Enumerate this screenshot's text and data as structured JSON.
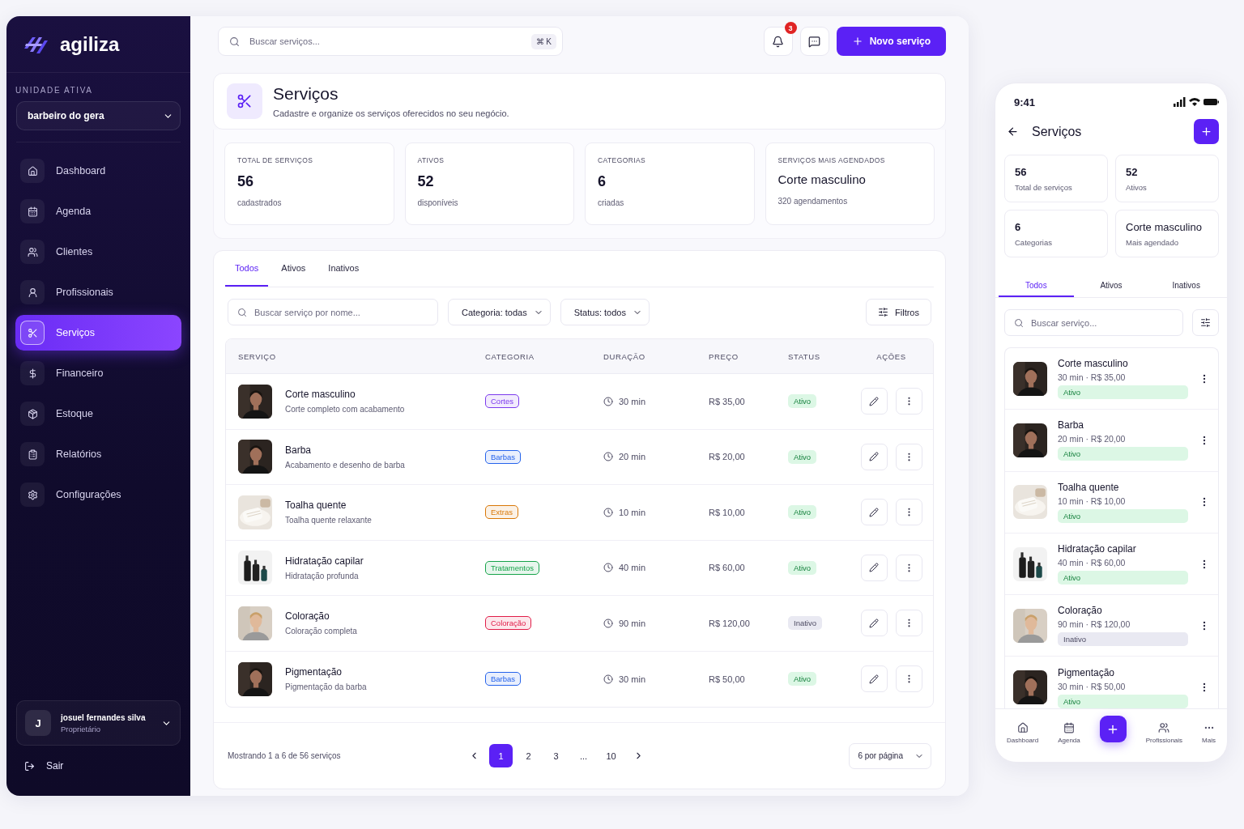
{
  "sidebar": {
    "brand": "agiliza",
    "unit_label": "UNIDADE ATIVA",
    "unit_value": "barbeiro do gera",
    "items": [
      {
        "label": "Dashboard",
        "selected": false
      },
      {
        "label": "Agenda",
        "selected": false
      },
      {
        "label": "Clientes",
        "selected": false
      },
      {
        "label": "Profissionais",
        "selected": false
      },
      {
        "label": "Serviços",
        "selected": true
      },
      {
        "label": "Financeiro",
        "selected": false
      },
      {
        "label": "Estoque",
        "selected": false
      },
      {
        "label": "Relatórios",
        "selected": false
      },
      {
        "label": "Configurações",
        "selected": false
      }
    ],
    "user": {
      "initial": "J",
      "name": "josuel fernandes silva",
      "role": "Proprietário"
    },
    "logout": "Sair"
  },
  "topbar": {
    "search_placeholder": "Buscar serviços...",
    "shortcut": "⌘ K",
    "notifications": "3",
    "new_button": "Novo serviço"
  },
  "header": {
    "title": "Serviços",
    "subtitle": "Cadastre e organize os serviços oferecidos no seu negócio."
  },
  "stats": [
    {
      "label": "TOTAL DE SERVIÇOS",
      "value": "56",
      "note": "cadastrados"
    },
    {
      "label": "ATIVOS",
      "value": "52",
      "note": "disponíveis"
    },
    {
      "label": "CATEGORIAS",
      "value": "6",
      "note": "criadas"
    },
    {
      "label": "SERVIÇOS MAIS AGENDADOS",
      "value": "Corte masculino",
      "note": "320 agendamentos"
    }
  ],
  "tabs": [
    {
      "label": "Todos",
      "selected": true
    },
    {
      "label": "Ativos",
      "selected": false
    },
    {
      "label": "Inativos",
      "selected": false
    }
  ],
  "filters": {
    "search_placeholder": "Buscar serviço por nome...",
    "category": "Categoria: todas",
    "status": "Status: todos",
    "more": "Filtros"
  },
  "table": {
    "columns": [
      "SERVIÇO",
      "CATEGORIA",
      "DURAÇÃO",
      "PREÇO",
      "STATUS",
      "AÇÕES"
    ],
    "rows": [
      {
        "name": "Corte masculino",
        "description": "Corte completo com acabamento",
        "category": "Cortes",
        "color": "#7c3aed",
        "duration": "30 min",
        "price": "R$ 35,00",
        "status": "Ativo",
        "active": true
      },
      {
        "name": "Barba",
        "description": "Acabamento e desenho de barba",
        "category": "Barbas",
        "color": "#2563eb",
        "duration": "20 min",
        "price": "R$ 20,00",
        "status": "Ativo",
        "active": true
      },
      {
        "name": "Toalha quente",
        "description": "Toalha quente relaxante",
        "category": "Extras",
        "color": "#d97706",
        "duration": "10 min",
        "price": "R$ 10,00",
        "status": "Ativo",
        "active": true
      },
      {
        "name": "Hidratação capilar",
        "description": "Hidratação profunda",
        "category": "Tratamentos",
        "color": "#16a34a",
        "duration": "40 min",
        "price": "R$ 60,00",
        "status": "Ativo",
        "active": true
      },
      {
        "name": "Coloração",
        "description": "Coloração completa",
        "category": "Coloração",
        "color": "#e11d48",
        "duration": "90 min",
        "price": "R$ 120,00",
        "status": "Inativo",
        "active": false
      },
      {
        "name": "Pigmentação",
        "description": "Pigmentação da barba",
        "category": "Barbas",
        "color": "#2563eb",
        "duration": "30 min",
        "price": "R$ 50,00",
        "status": "Ativo",
        "active": true
      }
    ]
  },
  "pagination": {
    "summary": "Mostrando 1 a 6 de 56 serviços",
    "pages": [
      {
        "label": "1",
        "selected": true
      },
      {
        "label": "2",
        "selected": false
      },
      {
        "label": "3",
        "selected": false
      },
      {
        "label": "...",
        "selected": false
      },
      {
        "label": "10",
        "selected": false
      }
    ],
    "per_page": "6 por página"
  },
  "mobile": {
    "time": "9:41",
    "title": "Serviços",
    "stats": [
      {
        "value": "56",
        "label": "Total de serviços"
      },
      {
        "value": "52",
        "label": "Ativos"
      },
      {
        "value": "6",
        "label": "Categorias"
      },
      {
        "value": "Corte masculino",
        "label": "Mais agendado"
      }
    ],
    "tabs": [
      {
        "label": "Todos",
        "selected": true
      },
      {
        "label": "Ativos",
        "selected": false
      },
      {
        "label": "Inativos",
        "selected": false
      }
    ],
    "search_placeholder": "Buscar serviço...",
    "items": [
      {
        "name": "Corte masculino",
        "meta": "30 min · R$ 35,00",
        "status": "Ativo",
        "active": true
      },
      {
        "name": "Barba",
        "meta": "20 min · R$ 20,00",
        "status": "Ativo",
        "active": true
      },
      {
        "name": "Toalha quente",
        "meta": "10 min · R$ 10,00",
        "status": "Ativo",
        "active": true
      },
      {
        "name": "Hidratação capilar",
        "meta": "40 min · R$ 60,00",
        "status": "Ativo",
        "active": true
      },
      {
        "name": "Coloração",
        "meta": "90 min · R$ 120,00",
        "status": "Inativo",
        "active": false
      },
      {
        "name": "Pigmentação",
        "meta": "30 min · R$ 50,00",
        "status": "Ativo",
        "active": true
      }
    ],
    "nav": [
      "Dashboard",
      "Agenda",
      "Profissionais",
      "Mais"
    ]
  }
}
